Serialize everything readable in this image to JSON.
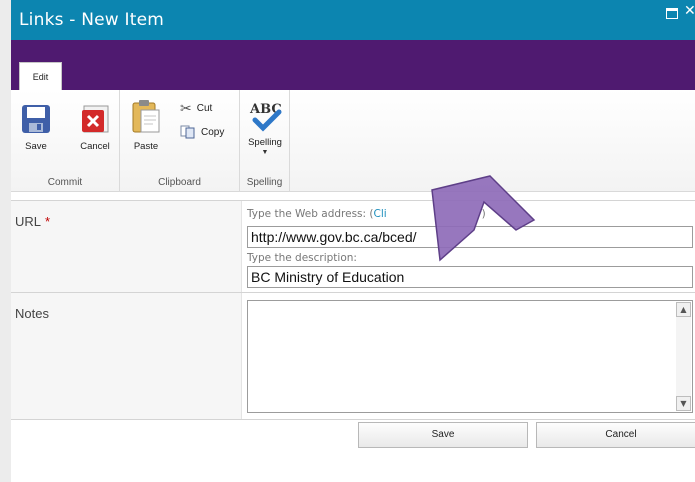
{
  "window": {
    "title": "Links - New Item"
  },
  "tabs": [
    {
      "label": "Edit"
    }
  ],
  "ribbon": {
    "commit": {
      "label": "Commit",
      "save": "Save",
      "cancel": "Cancel"
    },
    "clipboard": {
      "label": "Clipboard",
      "paste": "Paste",
      "cut": "Cut",
      "copy": "Copy"
    },
    "spelling": {
      "label": "Spelling",
      "button": "Spelling"
    }
  },
  "form": {
    "url": {
      "label": "URL",
      "required_mark": "*",
      "web_hint_prefix": "Type the Web address: (",
      "web_hint_link": "Cli",
      "web_hint_suffix": ")",
      "web_value": "http://www.gov.bc.ca/bced/",
      "desc_hint": "Type the description:",
      "desc_value": "BC Ministry of Education"
    },
    "notes": {
      "label": "Notes",
      "value": ""
    }
  },
  "actions": {
    "save": "Save",
    "cancel": "Cancel"
  },
  "colors": {
    "titlebar": "#0c85b0",
    "ribbon_band": "#4f1a70",
    "arrow": "#8e6bb8"
  }
}
